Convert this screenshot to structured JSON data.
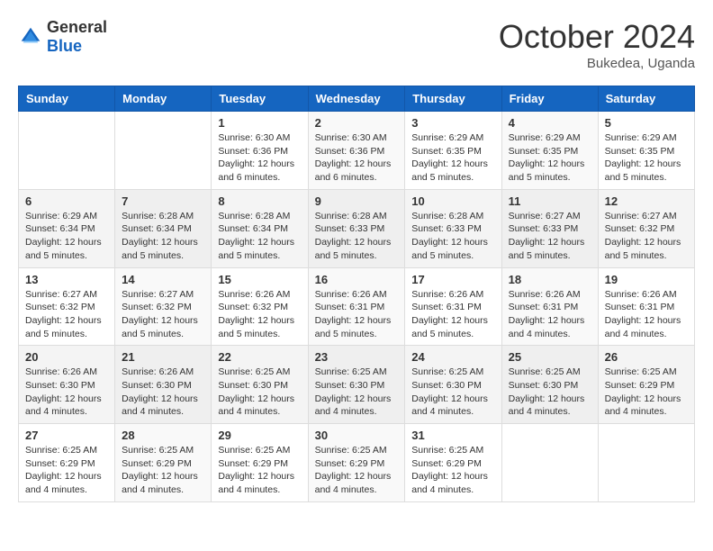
{
  "header": {
    "logo": {
      "general": "General",
      "blue": "Blue"
    },
    "title": "October 2024",
    "location": "Bukedea, Uganda"
  },
  "days_of_week": [
    "Sunday",
    "Monday",
    "Tuesday",
    "Wednesday",
    "Thursday",
    "Friday",
    "Saturday"
  ],
  "weeks": [
    [
      null,
      null,
      {
        "day": 1,
        "sunrise": "Sunrise: 6:30 AM",
        "sunset": "Sunset: 6:36 PM",
        "daylight": "Daylight: 12 hours and 6 minutes."
      },
      {
        "day": 2,
        "sunrise": "Sunrise: 6:30 AM",
        "sunset": "Sunset: 6:36 PM",
        "daylight": "Daylight: 12 hours and 6 minutes."
      },
      {
        "day": 3,
        "sunrise": "Sunrise: 6:29 AM",
        "sunset": "Sunset: 6:35 PM",
        "daylight": "Daylight: 12 hours and 5 minutes."
      },
      {
        "day": 4,
        "sunrise": "Sunrise: 6:29 AM",
        "sunset": "Sunset: 6:35 PM",
        "daylight": "Daylight: 12 hours and 5 minutes."
      },
      {
        "day": 5,
        "sunrise": "Sunrise: 6:29 AM",
        "sunset": "Sunset: 6:35 PM",
        "daylight": "Daylight: 12 hours and 5 minutes."
      }
    ],
    [
      {
        "day": 6,
        "sunrise": "Sunrise: 6:29 AM",
        "sunset": "Sunset: 6:34 PM",
        "daylight": "Daylight: 12 hours and 5 minutes."
      },
      {
        "day": 7,
        "sunrise": "Sunrise: 6:28 AM",
        "sunset": "Sunset: 6:34 PM",
        "daylight": "Daylight: 12 hours and 5 minutes."
      },
      {
        "day": 8,
        "sunrise": "Sunrise: 6:28 AM",
        "sunset": "Sunset: 6:34 PM",
        "daylight": "Daylight: 12 hours and 5 minutes."
      },
      {
        "day": 9,
        "sunrise": "Sunrise: 6:28 AM",
        "sunset": "Sunset: 6:33 PM",
        "daylight": "Daylight: 12 hours and 5 minutes."
      },
      {
        "day": 10,
        "sunrise": "Sunrise: 6:28 AM",
        "sunset": "Sunset: 6:33 PM",
        "daylight": "Daylight: 12 hours and 5 minutes."
      },
      {
        "day": 11,
        "sunrise": "Sunrise: 6:27 AM",
        "sunset": "Sunset: 6:33 PM",
        "daylight": "Daylight: 12 hours and 5 minutes."
      },
      {
        "day": 12,
        "sunrise": "Sunrise: 6:27 AM",
        "sunset": "Sunset: 6:32 PM",
        "daylight": "Daylight: 12 hours and 5 minutes."
      }
    ],
    [
      {
        "day": 13,
        "sunrise": "Sunrise: 6:27 AM",
        "sunset": "Sunset: 6:32 PM",
        "daylight": "Daylight: 12 hours and 5 minutes."
      },
      {
        "day": 14,
        "sunrise": "Sunrise: 6:27 AM",
        "sunset": "Sunset: 6:32 PM",
        "daylight": "Daylight: 12 hours and 5 minutes."
      },
      {
        "day": 15,
        "sunrise": "Sunrise: 6:26 AM",
        "sunset": "Sunset: 6:32 PM",
        "daylight": "Daylight: 12 hours and 5 minutes."
      },
      {
        "day": 16,
        "sunrise": "Sunrise: 6:26 AM",
        "sunset": "Sunset: 6:31 PM",
        "daylight": "Daylight: 12 hours and 5 minutes."
      },
      {
        "day": 17,
        "sunrise": "Sunrise: 6:26 AM",
        "sunset": "Sunset: 6:31 PM",
        "daylight": "Daylight: 12 hours and 5 minutes."
      },
      {
        "day": 18,
        "sunrise": "Sunrise: 6:26 AM",
        "sunset": "Sunset: 6:31 PM",
        "daylight": "Daylight: 12 hours and 4 minutes."
      },
      {
        "day": 19,
        "sunrise": "Sunrise: 6:26 AM",
        "sunset": "Sunset: 6:31 PM",
        "daylight": "Daylight: 12 hours and 4 minutes."
      }
    ],
    [
      {
        "day": 20,
        "sunrise": "Sunrise: 6:26 AM",
        "sunset": "Sunset: 6:30 PM",
        "daylight": "Daylight: 12 hours and 4 minutes."
      },
      {
        "day": 21,
        "sunrise": "Sunrise: 6:26 AM",
        "sunset": "Sunset: 6:30 PM",
        "daylight": "Daylight: 12 hours and 4 minutes."
      },
      {
        "day": 22,
        "sunrise": "Sunrise: 6:25 AM",
        "sunset": "Sunset: 6:30 PM",
        "daylight": "Daylight: 12 hours and 4 minutes."
      },
      {
        "day": 23,
        "sunrise": "Sunrise: 6:25 AM",
        "sunset": "Sunset: 6:30 PM",
        "daylight": "Daylight: 12 hours and 4 minutes."
      },
      {
        "day": 24,
        "sunrise": "Sunrise: 6:25 AM",
        "sunset": "Sunset: 6:30 PM",
        "daylight": "Daylight: 12 hours and 4 minutes."
      },
      {
        "day": 25,
        "sunrise": "Sunrise: 6:25 AM",
        "sunset": "Sunset: 6:30 PM",
        "daylight": "Daylight: 12 hours and 4 minutes."
      },
      {
        "day": 26,
        "sunrise": "Sunrise: 6:25 AM",
        "sunset": "Sunset: 6:29 PM",
        "daylight": "Daylight: 12 hours and 4 minutes."
      }
    ],
    [
      {
        "day": 27,
        "sunrise": "Sunrise: 6:25 AM",
        "sunset": "Sunset: 6:29 PM",
        "daylight": "Daylight: 12 hours and 4 minutes."
      },
      {
        "day": 28,
        "sunrise": "Sunrise: 6:25 AM",
        "sunset": "Sunset: 6:29 PM",
        "daylight": "Daylight: 12 hours and 4 minutes."
      },
      {
        "day": 29,
        "sunrise": "Sunrise: 6:25 AM",
        "sunset": "Sunset: 6:29 PM",
        "daylight": "Daylight: 12 hours and 4 minutes."
      },
      {
        "day": 30,
        "sunrise": "Sunrise: 6:25 AM",
        "sunset": "Sunset: 6:29 PM",
        "daylight": "Daylight: 12 hours and 4 minutes."
      },
      {
        "day": 31,
        "sunrise": "Sunrise: 6:25 AM",
        "sunset": "Sunset: 6:29 PM",
        "daylight": "Daylight: 12 hours and 4 minutes."
      },
      null,
      null
    ]
  ]
}
